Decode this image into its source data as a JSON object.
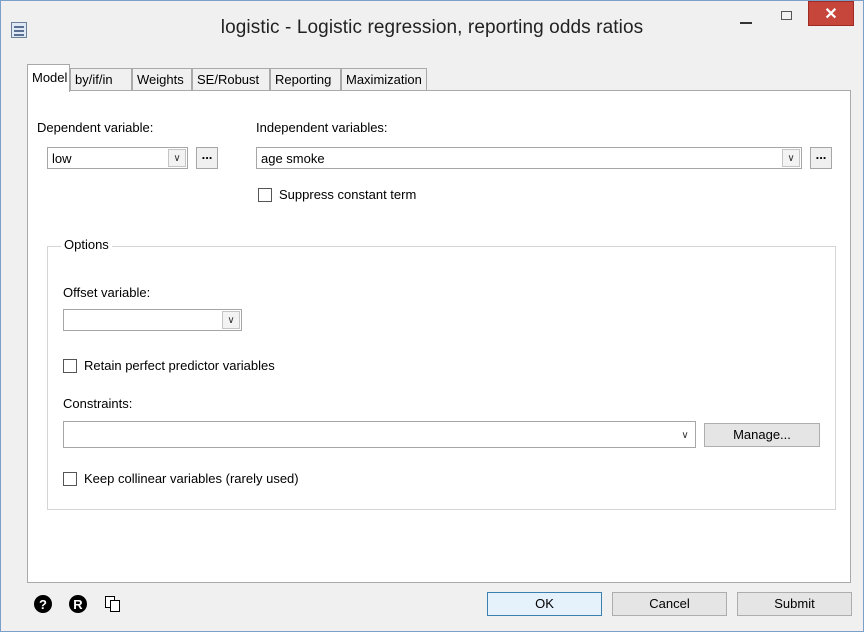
{
  "window": {
    "title": "logistic - Logistic regression, reporting odds ratios",
    "close_glyph": "✕"
  },
  "tabs": [
    {
      "label": "Model",
      "active": true
    },
    {
      "label": "by/if/in"
    },
    {
      "label": "Weights"
    },
    {
      "label": "SE/Robust"
    },
    {
      "label": "Reporting"
    },
    {
      "label": "Maximization"
    }
  ],
  "model": {
    "dependent_label": "Dependent variable:",
    "dependent_value": "low",
    "independent_label": "Independent variables:",
    "independent_value": "age smoke",
    "browse_label": "...",
    "suppress_constant_label": "Suppress constant term",
    "suppress_constant_checked": false
  },
  "options": {
    "group_title": "Options",
    "offset_label": "Offset variable:",
    "offset_value": "",
    "retain_label": "Retain perfect predictor variables",
    "retain_checked": false,
    "constraints_label": "Constraints:",
    "constraints_value": "",
    "manage_label": "Manage...",
    "collinear_label": "Keep collinear variables (rarely used)",
    "collinear_checked": false
  },
  "footer": {
    "ok_label": "OK",
    "cancel_label": "Cancel",
    "submit_label": "Submit",
    "help_glyph": "?",
    "reset_glyph": "R"
  },
  "icons": {
    "dropdown": "chevron-down-icon",
    "help": "help-icon",
    "reset": "reset-icon",
    "copy": "copy-command-icon"
  }
}
